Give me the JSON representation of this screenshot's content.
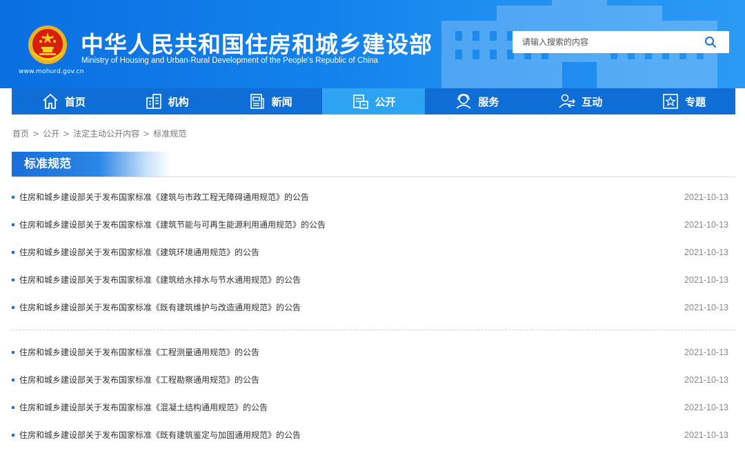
{
  "header": {
    "title_cn": "中华人民共和国住房和城乡建设部",
    "title_en": "Ministry of Housing and Urban-Rural Development of the People’s Republic of China",
    "site_url": "www.mohurd.gov.cn",
    "logo_icon": "national-emblem-icon",
    "search": {
      "placeholder": "请输入搜索的内容",
      "value": "",
      "icon": "search-icon"
    }
  },
  "nav": {
    "active_index": 3,
    "items": [
      {
        "label": "首页",
        "icon": "home-icon"
      },
      {
        "label": "机构",
        "icon": "building-icon"
      },
      {
        "label": "新闻",
        "icon": "news-icon"
      },
      {
        "label": "公开",
        "icon": "document-icon"
      },
      {
        "label": "服务",
        "icon": "service-icon"
      },
      {
        "label": "互动",
        "icon": "interaction-icon"
      },
      {
        "label": "专题",
        "icon": "star-icon"
      }
    ]
  },
  "breadcrumb": {
    "items": [
      "首页",
      "公开",
      "法定主动公开内容",
      "标准规范"
    ],
    "separator": ">"
  },
  "section": {
    "title": "标准规范"
  },
  "list": {
    "items": [
      {
        "title": "住房和城乡建设部关于发布国家标准《建筑与市政工程无障碍通用规范》的公告",
        "date": "2021-10-13"
      },
      {
        "title": "住房和城乡建设部关于发布国家标准《建筑节能与可再生能源利用通用规范》的公告",
        "date": "2021-10-13"
      },
      {
        "title": "住房和城乡建设部关于发布国家标准《建筑环境通用规范》的公告",
        "date": "2021-10-13"
      },
      {
        "title": "住房和城乡建设部关于发布国家标准《建筑给水排水与节水通用规范》的公告",
        "date": "2021-10-13"
      },
      {
        "title": "住房和城乡建设部关于发布国家标准《既有建筑维护与改造通用规范》的公告",
        "date": "2021-10-13"
      },
      {
        "title": "住房和城乡建设部关于发布国家标准《工程测量通用规范》的公告",
        "date": "2021-10-13"
      },
      {
        "title": "住房和城乡建设部关于发布国家标准《工程勘察通用规范》的公告",
        "date": "2021-10-13"
      },
      {
        "title": "住房和城乡建设部关于发布国家标准《混凝土结构通用规范》的公告",
        "date": "2021-10-13"
      },
      {
        "title": "住房和城乡建设部关于发布国家标准《既有建筑鉴定与加固通用规范》的公告",
        "date": "2021-10-13"
      }
    ]
  },
  "colors": {
    "header_blue": "#1383ec",
    "nav_blue": "#0f6ed6",
    "nav_active": "#2ea3f2",
    "bullet_blue": "#1f6fd6"
  }
}
